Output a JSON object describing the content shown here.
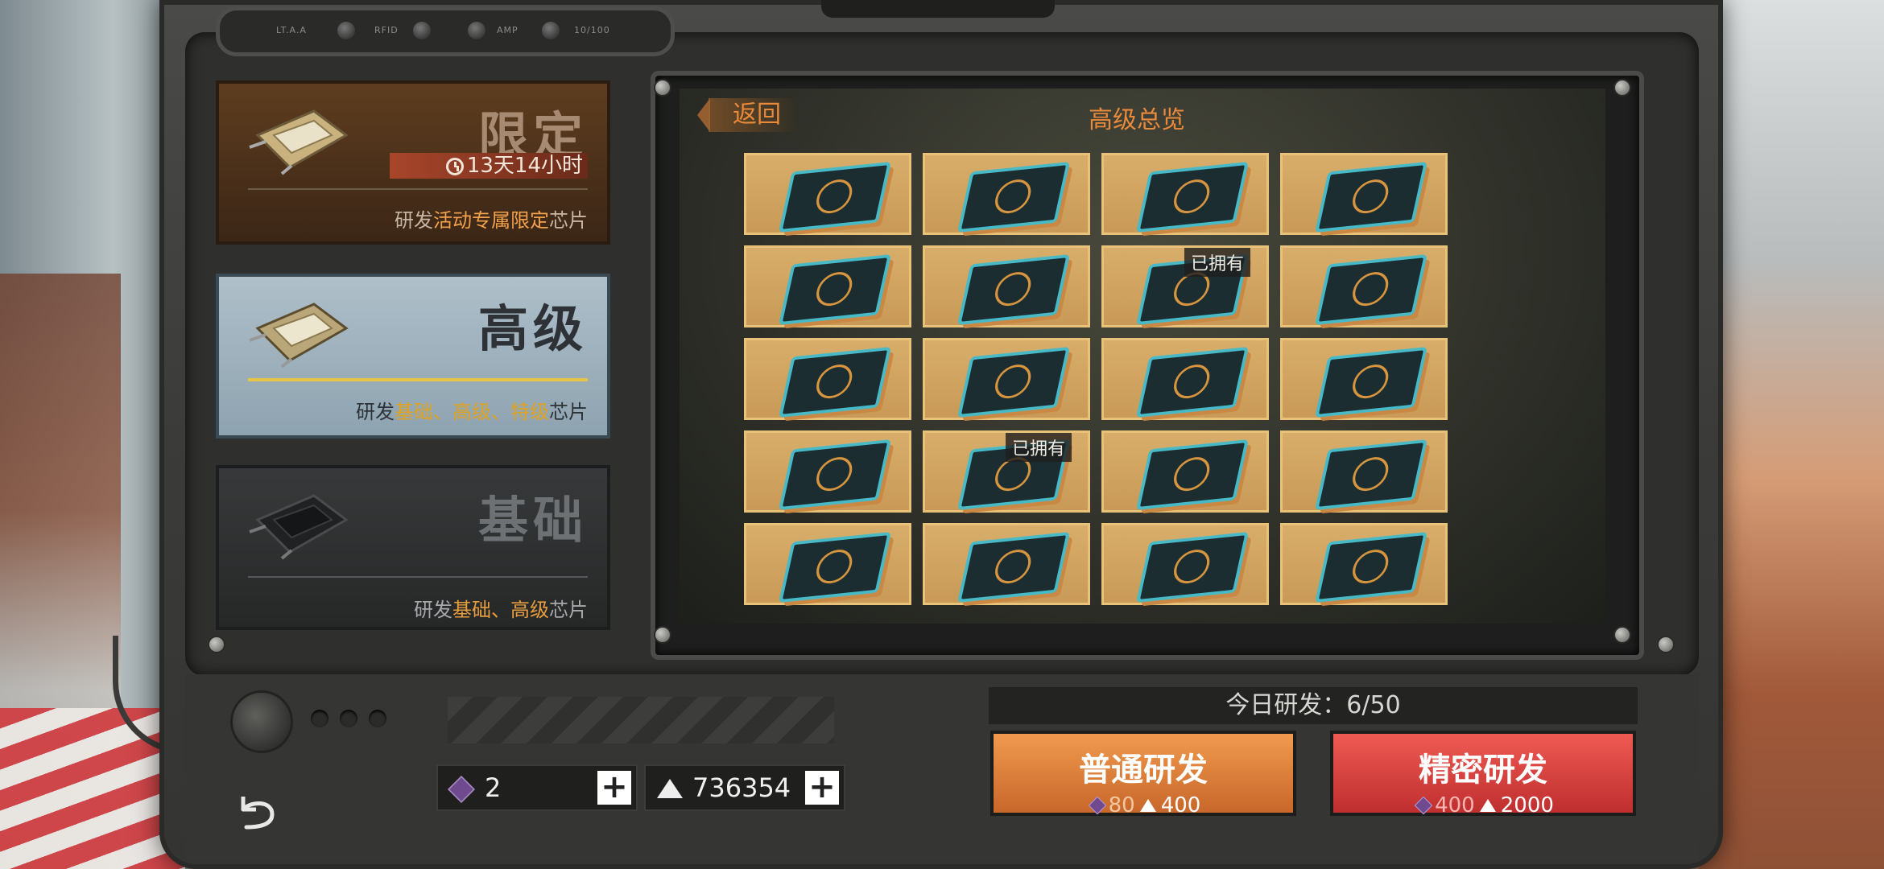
{
  "device": {
    "topbar_labels": [
      "LT.A.A",
      "RFID",
      "AMP",
      "10/100"
    ]
  },
  "categories": [
    {
      "id": "limited",
      "title": "限定",
      "timer": "13天14小时",
      "desc_prefix": "研发",
      "desc_highlight": "活动专属限定",
      "desc_suffix": "芯片"
    },
    {
      "id": "advanced",
      "title": "高级",
      "desc_prefix": "研发",
      "desc_highlight": "基础、高级、特级",
      "desc_suffix": "芯片",
      "selected": true
    },
    {
      "id": "basic",
      "title": "基础",
      "desc_prefix": "研发",
      "desc_highlight": "基础、高级",
      "desc_suffix": "芯片"
    }
  ],
  "screen": {
    "back_label": "返回",
    "title": "高级总览",
    "owned_label": "已拥有",
    "rows": 5,
    "cols": 4,
    "owned_tiles": [
      {
        "row": 1,
        "col": 2
      },
      {
        "row": 3,
        "col": 1
      }
    ]
  },
  "resources": {
    "gems": "2",
    "metal": "736354"
  },
  "daily": "今日研发：6/50",
  "actions": {
    "normal": {
      "label": "普通研发",
      "gem_cost": "80",
      "metal_cost": "400"
    },
    "precise": {
      "label": "精密研发",
      "gem_cost": "400",
      "metal_cost": "2000"
    }
  },
  "colors": {
    "accent_orange": "#e98a3a",
    "tile_gold": "#d8ad6a",
    "chip_cyan": "#47b9c7",
    "normal_button": "#e48a44",
    "precise_button": "#e04c46"
  },
  "icons": [
    "clock-icon",
    "chip-icon",
    "gem-icon",
    "metal-icon",
    "plus-icon",
    "return-arrow-icon",
    "back-arrow-icon"
  ]
}
